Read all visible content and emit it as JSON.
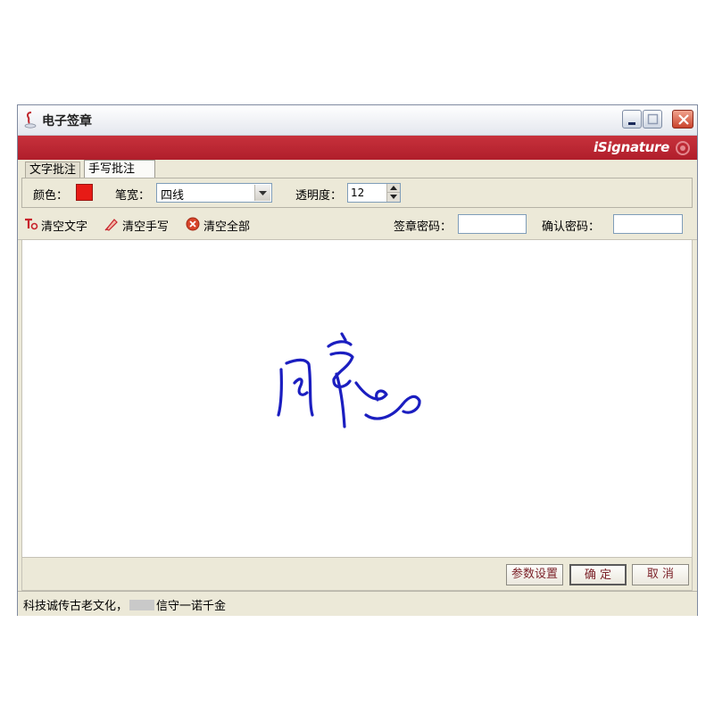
{
  "window": {
    "title": "电子签章"
  },
  "banner": {
    "brand": "iSignature"
  },
  "tabs": [
    {
      "label": "文字批注"
    },
    {
      "label": "手写批注"
    }
  ],
  "toolbar": {
    "color_label": "颜色：",
    "color_value": "#e71b16",
    "pen_width_label": "笔宽：",
    "pen_width_value": "四线",
    "opacity_label": "透明度：",
    "opacity_value": "12"
  },
  "actions": {
    "clear_text": "清空文字",
    "clear_handwriting": "清空手写",
    "clear_all": "清空全部",
    "seal_password_label": "签章密码：",
    "confirm_password_label": "确认密码："
  },
  "signature": {
    "ink_color": "#1b1ec0"
  },
  "buttons": {
    "settings": "参数设置",
    "ok": "确 定",
    "cancel": "取 消"
  },
  "status": {
    "text_before": "科技诚传古老文化，",
    "text_after": "信守一诺千金"
  }
}
